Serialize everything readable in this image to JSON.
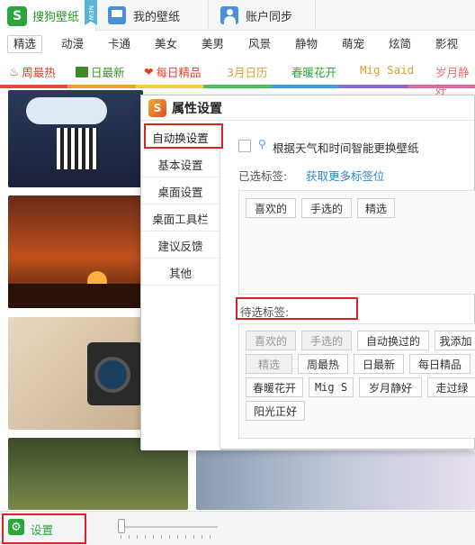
{
  "top_tabs": [
    {
      "label": "搜狗壁纸",
      "badge": "NEW"
    },
    {
      "label": "我的壁纸"
    },
    {
      "label": "账户同步"
    }
  ],
  "categories": [
    "精选",
    "动漫",
    "卡通",
    "美女",
    "美男",
    "风景",
    "静物",
    "萌宠",
    "炫简",
    "影视"
  ],
  "features": [
    {
      "label": "周最热",
      "icon": "flame-icon",
      "color": "#e0402a"
    },
    {
      "label": "日最新",
      "icon": "picture-icon",
      "color": "#3a8a2a"
    },
    {
      "label": "每日精品",
      "icon": "heart-icon",
      "color": "#e0402a"
    },
    {
      "label": "3月日历",
      "icon": "",
      "color": "#d9a030"
    },
    {
      "label": "春暖花开",
      "icon": "",
      "color": "#2aa63a"
    },
    {
      "label": "Mig Said",
      "icon": "",
      "color": "#d9a030"
    },
    {
      "label": "岁月静好",
      "icon": "",
      "color": "#e07070"
    }
  ],
  "stripe_colors": [
    "#e84a3a",
    "#f3a23a",
    "#f0d040",
    "#4ac060",
    "#3aa0e0",
    "#8a6ad0",
    "#e06aa0"
  ],
  "dialog": {
    "title": "属性设置",
    "logo": "S",
    "nav": [
      "自动换设置",
      "基本设置",
      "桌面设置",
      "桌面工具栏",
      "建议反馈",
      "其他"
    ],
    "smart_change_label": "根据天气和时间智能更换壁纸",
    "selected_tags_label": "已选标签:",
    "more_tags_link": "获取更多标签位",
    "selected_tags": [
      "喜欢的",
      "手选的",
      "精选"
    ],
    "candidate_label": "待选标签:",
    "candidate_tags": [
      {
        "label": "喜欢的",
        "dim": true
      },
      {
        "label": "手选的",
        "dim": true
      },
      {
        "label": "自动换过的",
        "dim": false
      },
      {
        "label": "我添加",
        "dim": false
      },
      {
        "label": "精选",
        "dim": true
      },
      {
        "label": "周最热",
        "dim": false
      },
      {
        "label": "日最新",
        "dim": false
      },
      {
        "label": "每日精品",
        "dim": false
      },
      {
        "label": "春暖花开",
        "dim": false
      },
      {
        "label": "Mig S",
        "dim": false
      },
      {
        "label": "岁月静好",
        "dim": false
      },
      {
        "label": "走过绿",
        "dim": false
      },
      {
        "label": "阳光正好",
        "dim": false
      }
    ]
  },
  "bottom": {
    "settings_label": "设置"
  }
}
